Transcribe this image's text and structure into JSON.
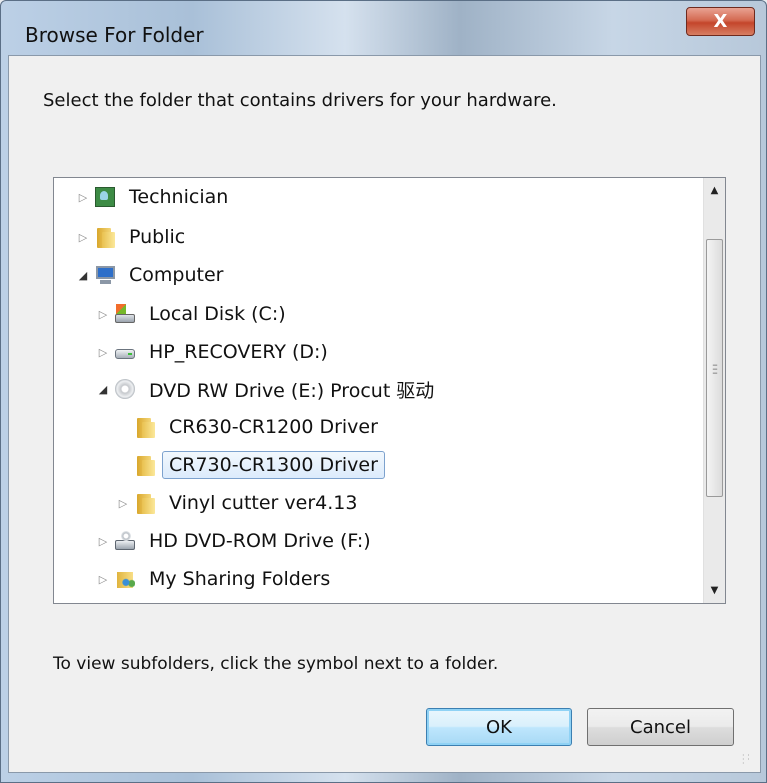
{
  "window": {
    "title": "Browse For Folder",
    "close_label": "X"
  },
  "dialog": {
    "description": "Select the folder that contains drivers for your hardware.",
    "hint": "To view subfolders, click the symbol next to a folder."
  },
  "tree": {
    "items": [
      {
        "label": "Technician",
        "expander": "▷",
        "icon": "user-folder-icon"
      },
      {
        "label": "Public",
        "expander": "▷",
        "icon": "folder-icon"
      },
      {
        "label": "Computer",
        "expander": "◢",
        "icon": "computer-icon"
      },
      {
        "label": "Local Disk (C:)",
        "expander": "▷",
        "icon": "local-disk-icon"
      },
      {
        "label": "HP_RECOVERY (D:)",
        "expander": "▷",
        "icon": "hard-drive-icon"
      },
      {
        "label": "DVD RW Drive (E:) Procut 驱动",
        "expander": "◢",
        "icon": "dvd-drive-icon"
      },
      {
        "label": "CR630-CR1200 Driver",
        "expander": "",
        "icon": "folder-icon"
      },
      {
        "label": "CR730-CR1300 Driver",
        "expander": "",
        "icon": "folder-icon",
        "selected": true
      },
      {
        "label": "Vinyl cutter ver4.13",
        "expander": "▷",
        "icon": "folder-icon"
      },
      {
        "label": "HD DVD-ROM Drive (F:)",
        "expander": "▷",
        "icon": "hd-dvd-drive-icon"
      },
      {
        "label": "My Sharing Folders",
        "expander": "▷",
        "icon": "sharing-folder-icon"
      }
    ],
    "scroll_up": "▲",
    "scroll_down": "▼"
  },
  "buttons": {
    "ok": "OK",
    "cancel": "Cancel"
  }
}
